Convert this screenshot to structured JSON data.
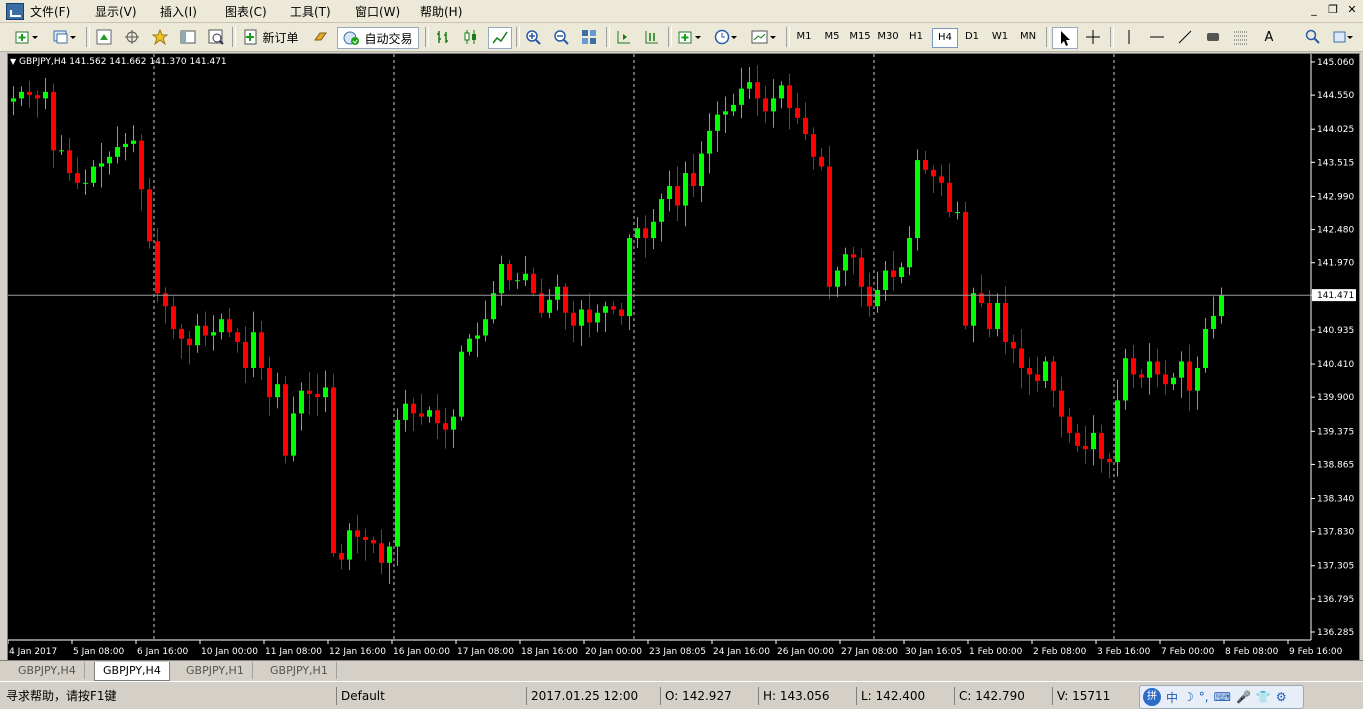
{
  "menu": {
    "items": [
      "文件(F)",
      "显示(V)",
      "插入(I)",
      "图表(C)",
      "工具(T)",
      "窗口(W)",
      "帮助(H)"
    ]
  },
  "toolbar": {
    "new_order_label": "新订单",
    "auto_trade_label": "自动交易",
    "timeframes": [
      "M1",
      "M5",
      "M15",
      "M30",
      "H1",
      "H4",
      "D1",
      "W1",
      "MN"
    ],
    "active_timeframe": "H4"
  },
  "chart": {
    "symbol_info": "GBPJPY,H4  141.562 141.662 141.370 141.471",
    "current_price_label": "141.471",
    "price_ticks": [
      "145.060",
      "144.550",
      "144.025",
      "143.515",
      "142.990",
      "142.480",
      "141.970",
      "141.471",
      "140.935",
      "140.410",
      "139.900",
      "139.375",
      "138.865",
      "138.340",
      "137.830",
      "137.305",
      "136.795",
      "136.285"
    ],
    "date_ticks": [
      "4 Jan 2017",
      "5 Jan 08:00",
      "6 Jan 16:00",
      "10 Jan 00:00",
      "11 Jan 08:00",
      "12 Jan 16:00",
      "16 Jan 00:00",
      "17 Jan 08:00",
      "18 Jan 16:00",
      "20 Jan 00:00",
      "23 Jan 08:05",
      "24 Jan 16:00",
      "26 Jan 00:00",
      "27 Jan 08:00",
      "30 Jan 16:05",
      "1 Feb 00:00",
      "2 Feb 08:00",
      "3 Feb 16:00",
      "7 Feb 00:00",
      "8 Feb 08:00",
      "9 Feb 16:00"
    ],
    "bull_color": "#00ff00",
    "bear_color": "#ff0000"
  },
  "chart_data": {
    "type": "candlestick",
    "series_name": "GBPJPY,H4",
    "ylim": [
      136.285,
      145.06
    ],
    "closes": [
      144.5,
      144.6,
      144.55,
      144.5,
      144.6,
      143.7,
      143.7,
      143.35,
      143.2,
      143.2,
      143.45,
      143.5,
      143.6,
      143.75,
      143.8,
      143.85,
      143.1,
      142.3,
      141.5,
      141.3,
      140.95,
      140.8,
      140.7,
      141.0,
      140.85,
      140.9,
      141.1,
      140.9,
      140.75,
      140.35,
      140.9,
      140.35,
      139.9,
      140.1,
      139.0,
      139.65,
      140.0,
      139.95,
      139.9,
      140.05,
      137.5,
      137.4,
      137.85,
      137.75,
      137.7,
      137.65,
      137.35,
      137.6,
      139.55,
      139.8,
      139.65,
      139.6,
      139.7,
      139.5,
      139.4,
      139.6,
      140.6,
      140.8,
      140.85,
      141.1,
      141.5,
      141.95,
      141.7,
      141.7,
      141.8,
      141.5,
      141.2,
      141.4,
      141.6,
      141.2,
      141.0,
      141.25,
      141.05,
      141.2,
      141.3,
      141.25,
      141.15,
      142.35,
      142.5,
      142.35,
      142.6,
      142.95,
      143.15,
      142.85,
      143.35,
      143.15,
      143.65,
      144.0,
      144.25,
      144.3,
      144.4,
      144.65,
      144.75,
      144.5,
      144.3,
      144.5,
      144.7,
      144.35,
      144.2,
      143.95,
      143.6,
      143.45,
      141.6,
      141.85,
      142.1,
      142.05,
      141.6,
      141.3,
      141.55,
      141.85,
      141.75,
      141.9,
      142.35,
      143.55,
      143.4,
      143.3,
      143.2,
      142.75,
      142.75,
      141.0,
      141.5,
      141.35,
      140.95,
      141.35,
      140.75,
      140.65,
      140.35,
      140.25,
      140.15,
      140.45,
      140.0,
      139.6,
      139.35,
      139.15,
      139.1,
      139.35,
      138.95,
      138.9,
      139.85,
      140.5,
      140.25,
      140.2,
      140.45,
      140.25,
      140.1,
      140.2,
      140.45,
      140.0,
      140.35,
      140.95,
      141.15,
      141.47
    ],
    "xlabel": "",
    "ylabel": ""
  },
  "tabs": [
    "GBPJPY,H4",
    "GBPJPY,H4",
    "GBPJPY,H1",
    "GBPJPY,H1"
  ],
  "active_tab_index": 1,
  "status": {
    "help": "寻求帮助，请按F1键",
    "profile": "Default",
    "datetime": "2017.01.25 12:00",
    "open": "O: 142.927",
    "high": "H: 143.056",
    "low": "L: 142.400",
    "close": "C: 142.790",
    "volume": "V: 15711",
    "ime_text": "中"
  }
}
